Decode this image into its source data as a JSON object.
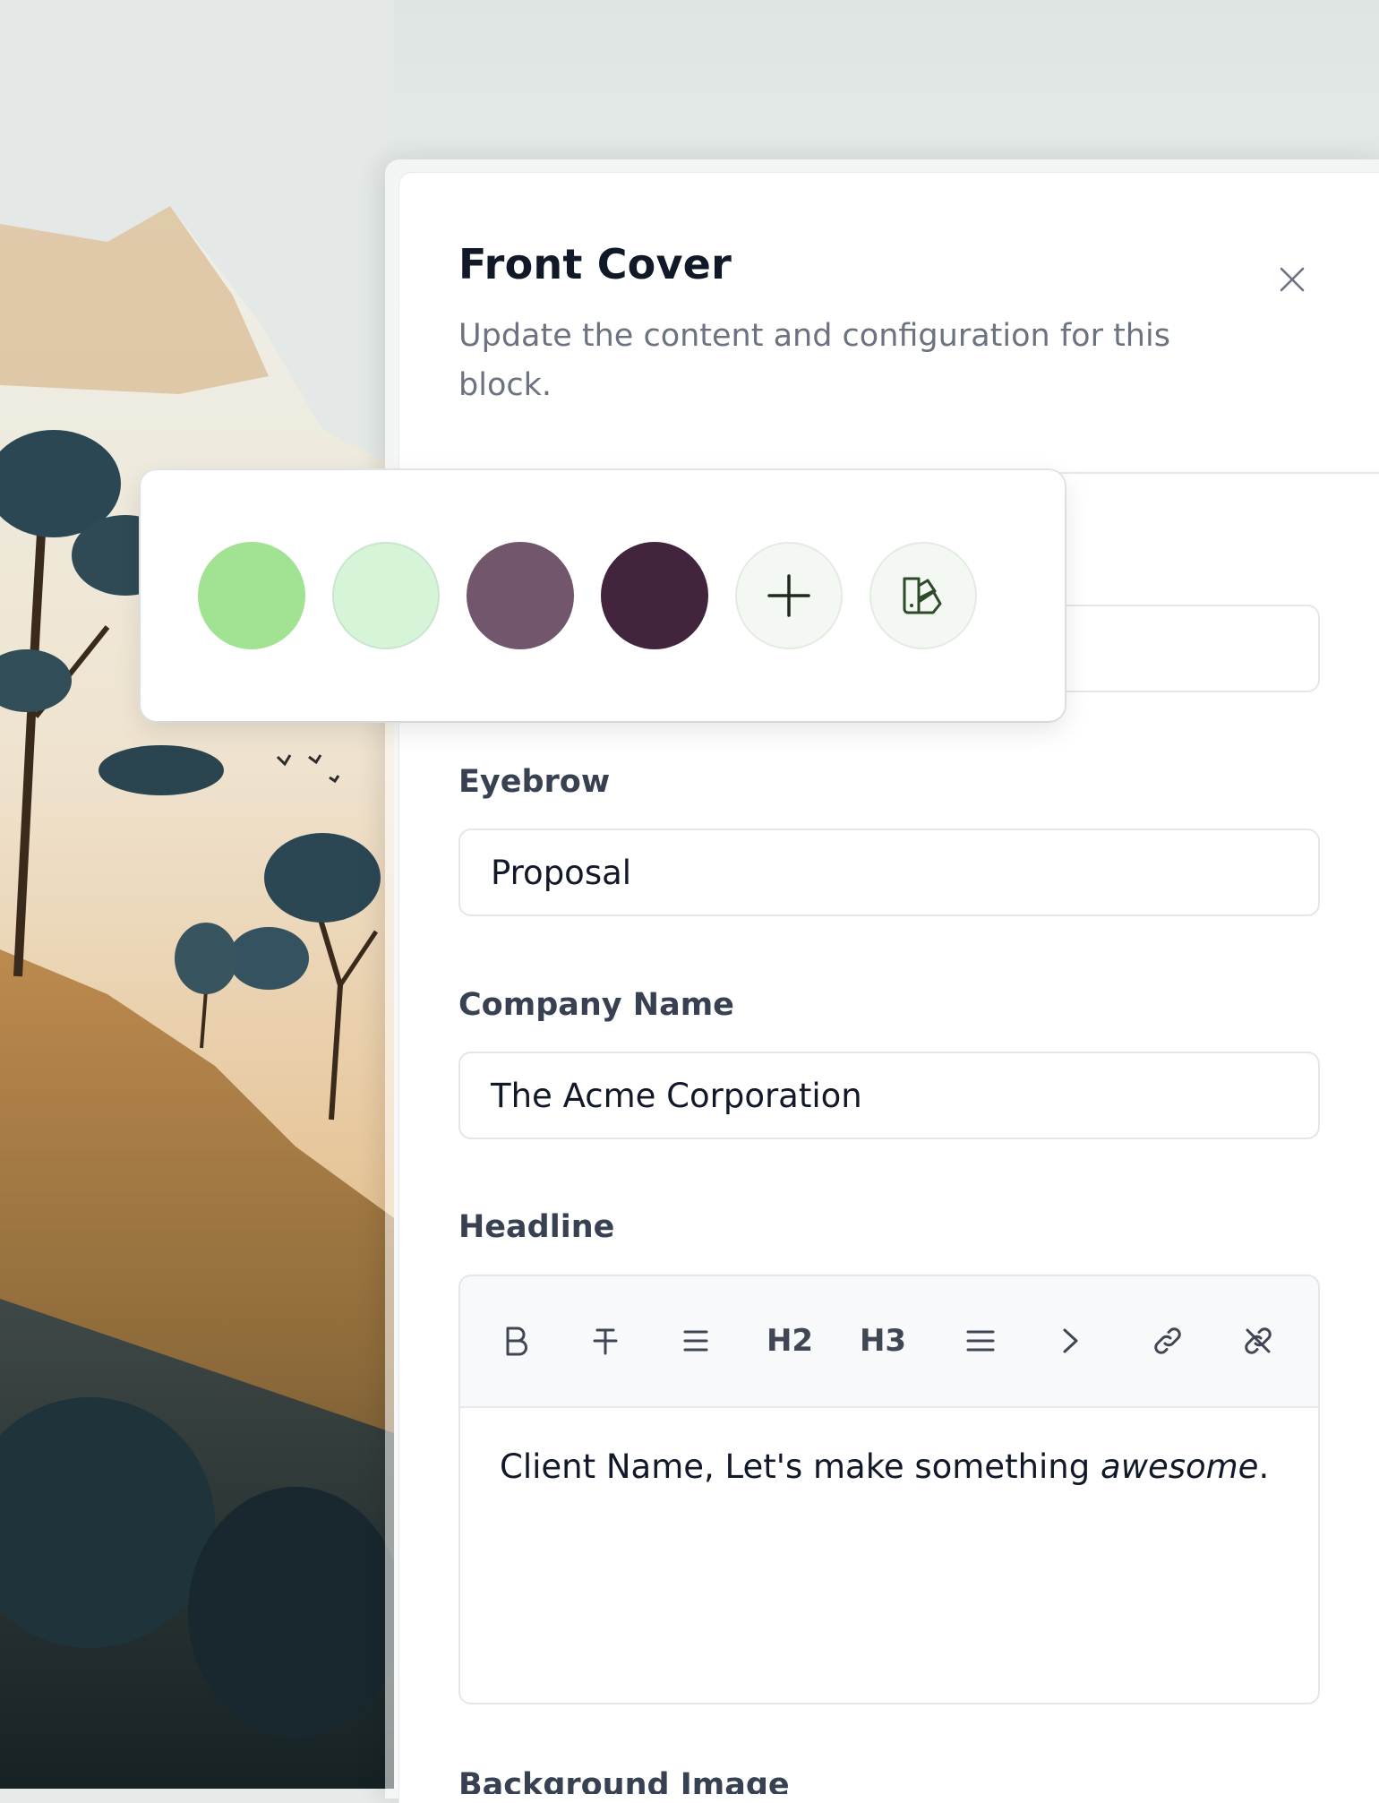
{
  "panel": {
    "title": "Front Cover",
    "subtitle": "Update the content and configuration for this block."
  },
  "fields": {
    "eyebrow": {
      "label": "Eyebrow",
      "value": "Proposal"
    },
    "company": {
      "label": "Company Name",
      "value": "The Acme Corporation"
    },
    "headline": {
      "label": "Headline",
      "text_before": "Client Name, Let's make something ",
      "text_emphasis": "awesome",
      "text_after": "."
    },
    "background": {
      "label": "Background Image"
    }
  },
  "toolbar": {
    "h2": "H2",
    "h3": "H3",
    "icons": [
      "bold-icon",
      "strikethrough-icon",
      "bullet-list-icon",
      "heading-2",
      "heading-3",
      "align-icon",
      "chevron-right-icon",
      "link-icon",
      "unlink-icon"
    ]
  },
  "palette": {
    "swatches": [
      "#a2e393",
      "#d6f5d8",
      "#72566b",
      "#42253d"
    ],
    "actions": [
      "plus-icon",
      "swatch-book-icon"
    ]
  }
}
